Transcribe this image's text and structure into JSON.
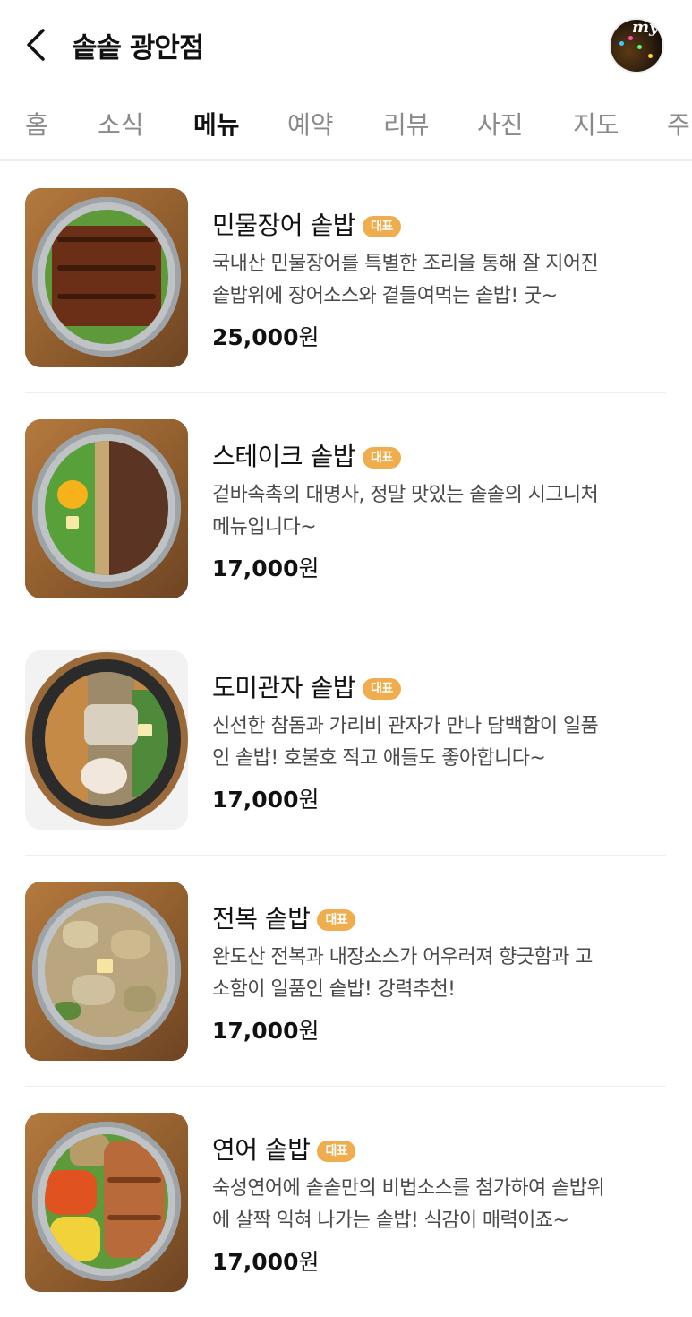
{
  "header": {
    "title": "솥솥 광안점",
    "avatar_text": "my"
  },
  "tabs": [
    {
      "label": "홈"
    },
    {
      "label": "소식"
    },
    {
      "label": "메뉴"
    },
    {
      "label": "예약"
    },
    {
      "label": "리뷰"
    },
    {
      "label": "사진"
    },
    {
      "label": "지도"
    },
    {
      "label": "주"
    }
  ],
  "active_tab": "메뉴",
  "colors": {
    "badge": "#f0ad4e",
    "text": "#111111",
    "muted": "#8a8a8a",
    "divider": "#eeeeee"
  },
  "menu": [
    {
      "name": "민물장어 솥밥",
      "badge": "대표",
      "desc_lines": [
        "국내산 민물장어를 특별한 조리을 통해 잘 지어진",
        "솥밥위에 장어소스와 곁들여먹는 솥밥! 굿~"
      ],
      "price_number": "25,000",
      "price_unit": "원"
    },
    {
      "name": "스테이크 솥밥",
      "badge": "대표",
      "desc_lines": [
        "겉바속촉의 대명사, 정말 맛있는 솥솥의 시그니처",
        "메뉴입니다~"
      ],
      "price_number": "17,000",
      "price_unit": "원"
    },
    {
      "name": "도미관자 솥밥",
      "badge": "대표",
      "desc_lines": [
        "신선한 참돔과 가리비 관자가 만나 담백함이 일품",
        "인 솥밥! 호불호 적고 애들도 좋아합니다~"
      ],
      "price_number": "17,000",
      "price_unit": "원"
    },
    {
      "name": "전복 솥밥",
      "badge": "대표",
      "desc_lines": [
        "완도산 전복과 내장소스가 어우러져 향긋함과 고",
        "소함이 일품인 솥밥! 강력추천!"
      ],
      "price_number": "17,000",
      "price_unit": "원"
    },
    {
      "name": "연어 솥밥",
      "badge": "대표",
      "desc_lines": [
        "숙성연어에 솥솥만의 비법소스를 첨가하여 솥밥위",
        "에 살짝 익혀 나가는 솥밥! 식감이 매력이죠~"
      ],
      "price_number": "17,000",
      "price_unit": "원"
    }
  ]
}
